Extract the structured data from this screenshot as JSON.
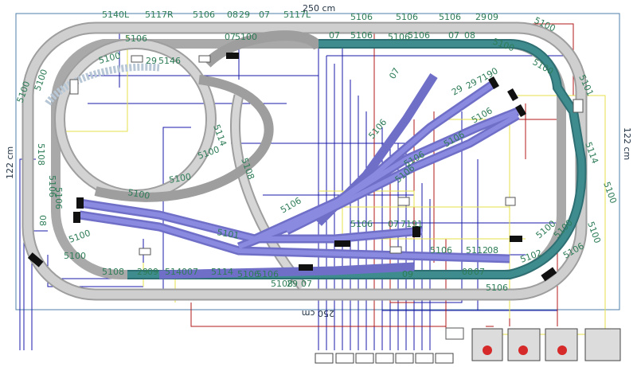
{
  "dimensions": {
    "width_label": "250 cm",
    "bottom_label": "250 cm",
    "height_label_left": "122 cm",
    "height_label_right": "122 cm"
  },
  "colors": {
    "outer_track": "#bdbdbd",
    "inner_track": "#2e6f73",
    "yard_track": "#6f6fc8",
    "wire_blue": "#1a1aa8",
    "wire_red": "#b01818",
    "wire_yellow": "#e6e24a",
    "label_green": "#2e7d57"
  },
  "track_labels": {
    "top": [
      "5140L",
      "5117R",
      "5106",
      "08",
      "29",
      "07",
      "5117L",
      "5106",
      "5106",
      "5106",
      "29",
      "09"
    ],
    "top_inner": [
      "5106",
      "07",
      "5100",
      "5106",
      "29",
      "5146",
      "5100",
      "07",
      "5106",
      "5106",
      "07",
      "08",
      "5100",
      "5100"
    ],
    "right": [
      "5100",
      "5101",
      "5114",
      "5100",
      "5100",
      "5100",
      "5102"
    ],
    "middle": [
      "5100",
      "5114",
      "5100",
      "5100",
      "5108",
      "5106",
      "5106",
      "5101",
      "07",
      "29",
      "29",
      "7190",
      "5106",
      "5106",
      "5106"
    ],
    "yard": [
      "5106",
      "5106",
      "07",
      "7191",
      "5106",
      "5112",
      "08",
      "5100",
      "5106"
    ],
    "left": [
      "5100",
      "5100",
      "5106",
      "5108",
      "5106",
      "5100",
      "5100",
      "08"
    ],
    "bottom": [
      "5108",
      "29",
      "09",
      "5140",
      "07",
      "5114",
      "5106",
      "5106",
      "5108",
      "29",
      "07",
      "09",
      "08",
      "07",
      "5106"
    ]
  },
  "control_panel": {
    "buttons": [
      "red",
      "red",
      "red",
      "empty"
    ]
  }
}
